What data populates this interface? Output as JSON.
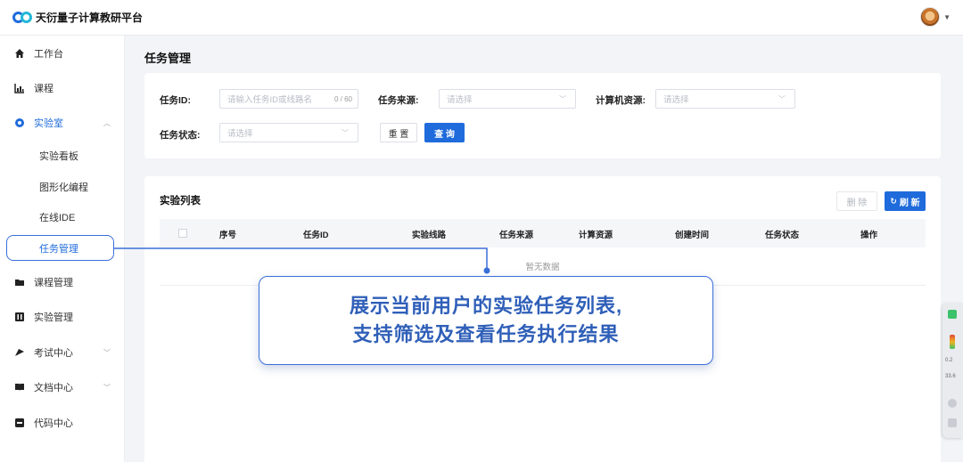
{
  "app": {
    "title": "天衍量子计算教研平台"
  },
  "sidebar": {
    "items": [
      {
        "label": "工作台",
        "icon": "home-icon"
      },
      {
        "label": "课程",
        "icon": "chart-icon"
      },
      {
        "label": "实验室",
        "icon": "lab-icon"
      },
      {
        "label": "课程管理",
        "icon": "folder-icon"
      },
      {
        "label": "实验管理",
        "icon": "experiment-icon"
      },
      {
        "label": "考试中心",
        "icon": "exam-icon"
      },
      {
        "label": "文档中心",
        "icon": "book-icon"
      },
      {
        "label": "代码中心",
        "icon": "code-icon"
      }
    ],
    "lab_children": [
      {
        "label": "实验看板"
      },
      {
        "label": "图形化编程"
      },
      {
        "label": "在线IDE"
      },
      {
        "label": "任务管理"
      }
    ]
  },
  "page": {
    "title": "任务管理"
  },
  "filters": {
    "task_id_label": "任务ID:",
    "task_id_placeholder": "请输入任务ID或线路名",
    "task_id_count": "0 / 60",
    "source_label": "任务来源:",
    "source_placeholder": "请选择",
    "resource_label": "计算机资源:",
    "resource_placeholder": "请选择",
    "status_label": "任务状态:",
    "status_placeholder": "请选择",
    "reset_label": "重 置",
    "query_label": "查 询"
  },
  "list": {
    "title": "实验列表",
    "delete_label": "删 除",
    "refresh_label": "刷 新",
    "columns": [
      "序号",
      "任务ID",
      "实验线路",
      "任务来源",
      "计算资源",
      "创建时间",
      "任务状态",
      "操作"
    ],
    "empty_text": "暂无数据"
  },
  "callout": {
    "line1": "展示当前用户的实验任务列表,",
    "line2": "支持筛选及查看任务执行结果"
  },
  "floatbar": {
    "v1": "0.2",
    "v2": "33.6"
  },
  "colors": {
    "primary": "#1f6bdc",
    "accent": "#22b8d6"
  }
}
